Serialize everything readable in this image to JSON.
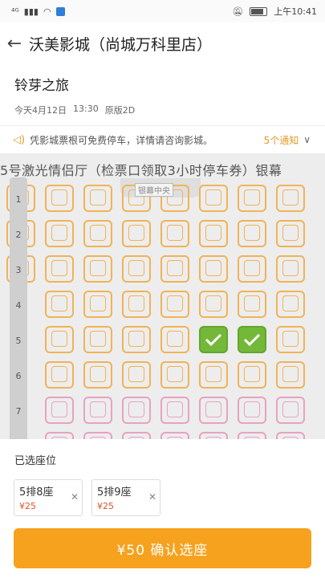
{
  "status_bar": {
    "signal": "⁴ᴳ",
    "time": "上午10:41"
  },
  "header": {
    "title": "沃美影城（尚城万科里店）"
  },
  "movie": {
    "title": "铃芽之旅",
    "date": "今天4月12日",
    "time": "13:30",
    "version": "原版2D"
  },
  "notice": {
    "text": "凭影城票根可免费停车，详情请咨询影城。",
    "count_label": "5个通知"
  },
  "hall": {
    "name": "5号激光情侣厅（检票口领取3小时停车券）银幕",
    "screen_label": "银幕中央"
  },
  "rows": [
    "1",
    "2",
    "3",
    "4",
    "5",
    "6",
    "7"
  ],
  "seat_map": {
    "selected_row": 5,
    "selected_cols": [
      5,
      6
    ],
    "pink_rows": [
      7,
      8
    ],
    "columns": 8
  },
  "colors": {
    "seat_normal": "#f1b356",
    "seat_couple": "#e8a2c0",
    "seat_selected": "#74b83a",
    "accent": "#f6a21e"
  },
  "selection": {
    "title": "已选座位",
    "tickets": [
      {
        "seat": "5排8座",
        "price": "¥25"
      },
      {
        "seat": "5排9座",
        "price": "¥25"
      }
    ]
  },
  "confirm": {
    "label": "¥50 确认选座"
  }
}
